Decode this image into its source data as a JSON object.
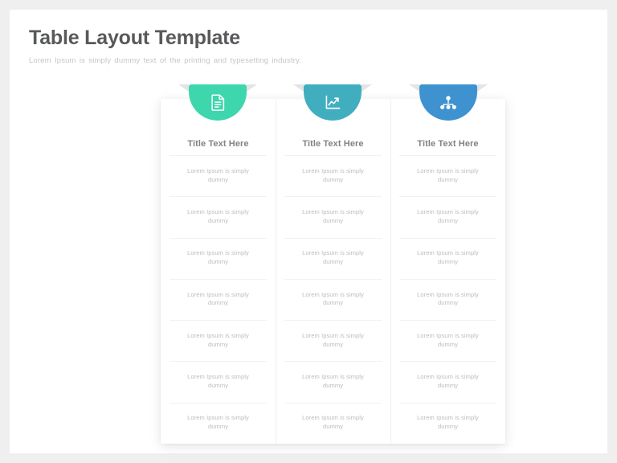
{
  "header": {
    "title": "Table Layout Template",
    "subtitle": "Lorem Ipsum is simply dummy text of the printing and typesetting industry."
  },
  "colors": {
    "background": "#efefef",
    "slide": "#ffffff",
    "title_text": "#58595b",
    "subtitle_text": "#c4c6c8",
    "column_header_text": "#808285",
    "cell_text": "#b9bbbd",
    "divider": "#f0f0f0",
    "ribbon_tail": "#e3e4e5",
    "tab_green": "#3dd6ad",
    "tab_teal": "#41aec0",
    "tab_blue": "#3e92d0"
  },
  "table": {
    "tabs": [
      {
        "icon": "document-icon",
        "color": "#3dd6ad"
      },
      {
        "icon": "line-chart-icon",
        "color": "#41aec0"
      },
      {
        "icon": "team-network-icon",
        "color": "#3e92d0"
      }
    ],
    "columns": [
      {
        "header": "Title Text Here",
        "cells": [
          "Lorem Ipsum is simply dummy",
          "Lorem Ipsum is simply dummy",
          "Lorem Ipsum is simply dummy",
          "Lorem Ipsum is simply dummy",
          "Lorem Ipsum is simply dummy",
          "Lorem Ipsum is simply dummy",
          "Lorem Ipsum is simply dummy"
        ]
      },
      {
        "header": "Title Text Here",
        "cells": [
          "Lorem Ipsum is simply dummy",
          "Lorem Ipsum is simply dummy",
          "Lorem Ipsum is simply dummy",
          "Lorem Ipsum is simply dummy",
          "Lorem Ipsum is simply dummy",
          "Lorem Ipsum is simply dummy",
          "Lorem Ipsum is simply dummy"
        ]
      },
      {
        "header": "Title Text Here",
        "cells": [
          "Lorem Ipsum is simply dummy",
          "Lorem Ipsum is simply dummy",
          "Lorem Ipsum is simply dummy",
          "Lorem Ipsum is simply dummy",
          "Lorem Ipsum is simply dummy",
          "Lorem Ipsum is simply dummy",
          "Lorem Ipsum is simply dummy"
        ]
      }
    ]
  }
}
